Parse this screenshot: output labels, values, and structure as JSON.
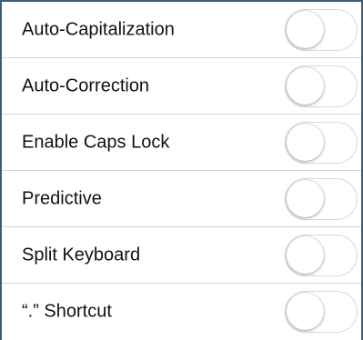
{
  "settings": {
    "rows": [
      {
        "label": "Auto-Capitalization",
        "switch_on": false
      },
      {
        "label": "Auto-Correction",
        "switch_on": false
      },
      {
        "label": "Enable Caps Lock",
        "switch_on": false
      },
      {
        "label": "Predictive",
        "switch_on": false
      },
      {
        "label": "Split Keyboard",
        "switch_on": false
      },
      {
        "label": "“.” Shortcut",
        "switch_on": false
      }
    ]
  },
  "colors": {
    "border": "#3d5f7a",
    "separator": "#d6d6d9",
    "switch_track_off": "#ffffff"
  }
}
